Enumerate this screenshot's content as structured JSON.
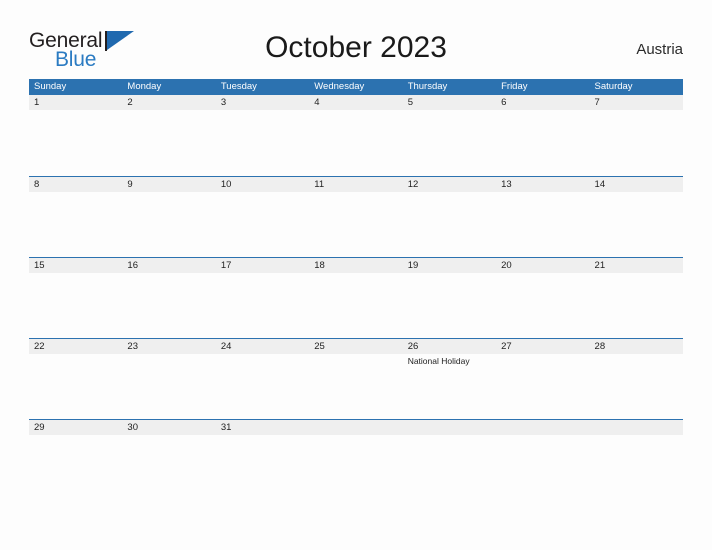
{
  "brand": {
    "line1": "General",
    "line2": "Blue",
    "flag_icon": "blue-flag-triangle-icon"
  },
  "header": {
    "title": "October 2023",
    "region": "Austria"
  },
  "colors": {
    "header_blue": "#2C72B0",
    "brand_blue": "#2B7BC2",
    "day_strip_gray": "#EFEFEF",
    "page_background": "#FDFDFD",
    "text_dark": "#1F1F1F"
  },
  "calendar": {
    "weekdays": [
      "Sunday",
      "Monday",
      "Tuesday",
      "Wednesday",
      "Thursday",
      "Friday",
      "Saturday"
    ],
    "weeks": [
      {
        "days": [
          {
            "number": "1",
            "events": []
          },
          {
            "number": "2",
            "events": []
          },
          {
            "number": "3",
            "events": []
          },
          {
            "number": "4",
            "events": []
          },
          {
            "number": "5",
            "events": []
          },
          {
            "number": "6",
            "events": []
          },
          {
            "number": "7",
            "events": []
          }
        ]
      },
      {
        "days": [
          {
            "number": "8",
            "events": []
          },
          {
            "number": "9",
            "events": []
          },
          {
            "number": "10",
            "events": []
          },
          {
            "number": "11",
            "events": []
          },
          {
            "number": "12",
            "events": []
          },
          {
            "number": "13",
            "events": []
          },
          {
            "number": "14",
            "events": []
          }
        ]
      },
      {
        "days": [
          {
            "number": "15",
            "events": []
          },
          {
            "number": "16",
            "events": []
          },
          {
            "number": "17",
            "events": []
          },
          {
            "number": "18",
            "events": []
          },
          {
            "number": "19",
            "events": []
          },
          {
            "number": "20",
            "events": []
          },
          {
            "number": "21",
            "events": []
          }
        ]
      },
      {
        "days": [
          {
            "number": "22",
            "events": []
          },
          {
            "number": "23",
            "events": []
          },
          {
            "number": "24",
            "events": []
          },
          {
            "number": "25",
            "events": []
          },
          {
            "number": "26",
            "events": [
              "National Holiday"
            ]
          },
          {
            "number": "27",
            "events": []
          },
          {
            "number": "28",
            "events": []
          }
        ]
      },
      {
        "days": [
          {
            "number": "29",
            "events": []
          },
          {
            "number": "30",
            "events": []
          },
          {
            "number": "31",
            "events": []
          },
          {
            "number": "",
            "events": []
          },
          {
            "number": "",
            "events": []
          },
          {
            "number": "",
            "events": []
          },
          {
            "number": "",
            "events": []
          }
        ]
      }
    ]
  }
}
